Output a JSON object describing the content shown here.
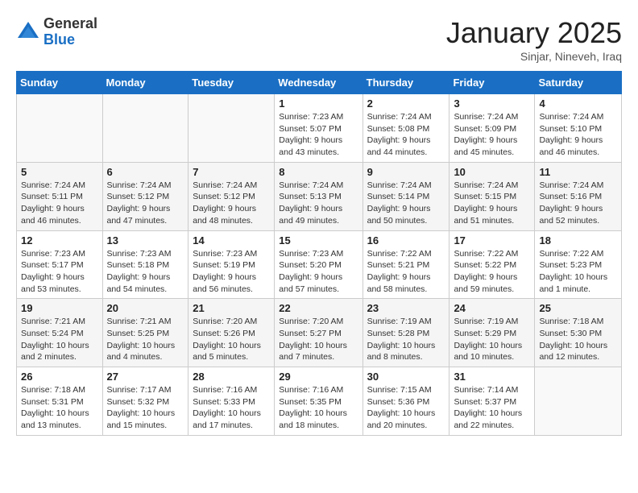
{
  "logo": {
    "general": "General",
    "blue": "Blue"
  },
  "title": "January 2025",
  "location": "Sinjar, Nineveh, Iraq",
  "weekdays": [
    "Sunday",
    "Monday",
    "Tuesday",
    "Wednesday",
    "Thursday",
    "Friday",
    "Saturday"
  ],
  "weeks": [
    [
      {
        "day": "",
        "sunrise": "",
        "sunset": "",
        "daylight": ""
      },
      {
        "day": "",
        "sunrise": "",
        "sunset": "",
        "daylight": ""
      },
      {
        "day": "",
        "sunrise": "",
        "sunset": "",
        "daylight": ""
      },
      {
        "day": "1",
        "sunrise": "Sunrise: 7:23 AM",
        "sunset": "Sunset: 5:07 PM",
        "daylight": "Daylight: 9 hours and 43 minutes."
      },
      {
        "day": "2",
        "sunrise": "Sunrise: 7:24 AM",
        "sunset": "Sunset: 5:08 PM",
        "daylight": "Daylight: 9 hours and 44 minutes."
      },
      {
        "day": "3",
        "sunrise": "Sunrise: 7:24 AM",
        "sunset": "Sunset: 5:09 PM",
        "daylight": "Daylight: 9 hours and 45 minutes."
      },
      {
        "day": "4",
        "sunrise": "Sunrise: 7:24 AM",
        "sunset": "Sunset: 5:10 PM",
        "daylight": "Daylight: 9 hours and 46 minutes."
      }
    ],
    [
      {
        "day": "5",
        "sunrise": "Sunrise: 7:24 AM",
        "sunset": "Sunset: 5:11 PM",
        "daylight": "Daylight: 9 hours and 46 minutes."
      },
      {
        "day": "6",
        "sunrise": "Sunrise: 7:24 AM",
        "sunset": "Sunset: 5:12 PM",
        "daylight": "Daylight: 9 hours and 47 minutes."
      },
      {
        "day": "7",
        "sunrise": "Sunrise: 7:24 AM",
        "sunset": "Sunset: 5:12 PM",
        "daylight": "Daylight: 9 hours and 48 minutes."
      },
      {
        "day": "8",
        "sunrise": "Sunrise: 7:24 AM",
        "sunset": "Sunset: 5:13 PM",
        "daylight": "Daylight: 9 hours and 49 minutes."
      },
      {
        "day": "9",
        "sunrise": "Sunrise: 7:24 AM",
        "sunset": "Sunset: 5:14 PM",
        "daylight": "Daylight: 9 hours and 50 minutes."
      },
      {
        "day": "10",
        "sunrise": "Sunrise: 7:24 AM",
        "sunset": "Sunset: 5:15 PM",
        "daylight": "Daylight: 9 hours and 51 minutes."
      },
      {
        "day": "11",
        "sunrise": "Sunrise: 7:24 AM",
        "sunset": "Sunset: 5:16 PM",
        "daylight": "Daylight: 9 hours and 52 minutes."
      }
    ],
    [
      {
        "day": "12",
        "sunrise": "Sunrise: 7:23 AM",
        "sunset": "Sunset: 5:17 PM",
        "daylight": "Daylight: 9 hours and 53 minutes."
      },
      {
        "day": "13",
        "sunrise": "Sunrise: 7:23 AM",
        "sunset": "Sunset: 5:18 PM",
        "daylight": "Daylight: 9 hours and 54 minutes."
      },
      {
        "day": "14",
        "sunrise": "Sunrise: 7:23 AM",
        "sunset": "Sunset: 5:19 PM",
        "daylight": "Daylight: 9 hours and 56 minutes."
      },
      {
        "day": "15",
        "sunrise": "Sunrise: 7:23 AM",
        "sunset": "Sunset: 5:20 PM",
        "daylight": "Daylight: 9 hours and 57 minutes."
      },
      {
        "day": "16",
        "sunrise": "Sunrise: 7:22 AM",
        "sunset": "Sunset: 5:21 PM",
        "daylight": "Daylight: 9 hours and 58 minutes."
      },
      {
        "day": "17",
        "sunrise": "Sunrise: 7:22 AM",
        "sunset": "Sunset: 5:22 PM",
        "daylight": "Daylight: 9 hours and 59 minutes."
      },
      {
        "day": "18",
        "sunrise": "Sunrise: 7:22 AM",
        "sunset": "Sunset: 5:23 PM",
        "daylight": "Daylight: 10 hours and 1 minute."
      }
    ],
    [
      {
        "day": "19",
        "sunrise": "Sunrise: 7:21 AM",
        "sunset": "Sunset: 5:24 PM",
        "daylight": "Daylight: 10 hours and 2 minutes."
      },
      {
        "day": "20",
        "sunrise": "Sunrise: 7:21 AM",
        "sunset": "Sunset: 5:25 PM",
        "daylight": "Daylight: 10 hours and 4 minutes."
      },
      {
        "day": "21",
        "sunrise": "Sunrise: 7:20 AM",
        "sunset": "Sunset: 5:26 PM",
        "daylight": "Daylight: 10 hours and 5 minutes."
      },
      {
        "day": "22",
        "sunrise": "Sunrise: 7:20 AM",
        "sunset": "Sunset: 5:27 PM",
        "daylight": "Daylight: 10 hours and 7 minutes."
      },
      {
        "day": "23",
        "sunrise": "Sunrise: 7:19 AM",
        "sunset": "Sunset: 5:28 PM",
        "daylight": "Daylight: 10 hours and 8 minutes."
      },
      {
        "day": "24",
        "sunrise": "Sunrise: 7:19 AM",
        "sunset": "Sunset: 5:29 PM",
        "daylight": "Daylight: 10 hours and 10 minutes."
      },
      {
        "day": "25",
        "sunrise": "Sunrise: 7:18 AM",
        "sunset": "Sunset: 5:30 PM",
        "daylight": "Daylight: 10 hours and 12 minutes."
      }
    ],
    [
      {
        "day": "26",
        "sunrise": "Sunrise: 7:18 AM",
        "sunset": "Sunset: 5:31 PM",
        "daylight": "Daylight: 10 hours and 13 minutes."
      },
      {
        "day": "27",
        "sunrise": "Sunrise: 7:17 AM",
        "sunset": "Sunset: 5:32 PM",
        "daylight": "Daylight: 10 hours and 15 minutes."
      },
      {
        "day": "28",
        "sunrise": "Sunrise: 7:16 AM",
        "sunset": "Sunset: 5:33 PM",
        "daylight": "Daylight: 10 hours and 17 minutes."
      },
      {
        "day": "29",
        "sunrise": "Sunrise: 7:16 AM",
        "sunset": "Sunset: 5:35 PM",
        "daylight": "Daylight: 10 hours and 18 minutes."
      },
      {
        "day": "30",
        "sunrise": "Sunrise: 7:15 AM",
        "sunset": "Sunset: 5:36 PM",
        "daylight": "Daylight: 10 hours and 20 minutes."
      },
      {
        "day": "31",
        "sunrise": "Sunrise: 7:14 AM",
        "sunset": "Sunset: 5:37 PM",
        "daylight": "Daylight: 10 hours and 22 minutes."
      },
      {
        "day": "",
        "sunrise": "",
        "sunset": "",
        "daylight": ""
      }
    ]
  ]
}
